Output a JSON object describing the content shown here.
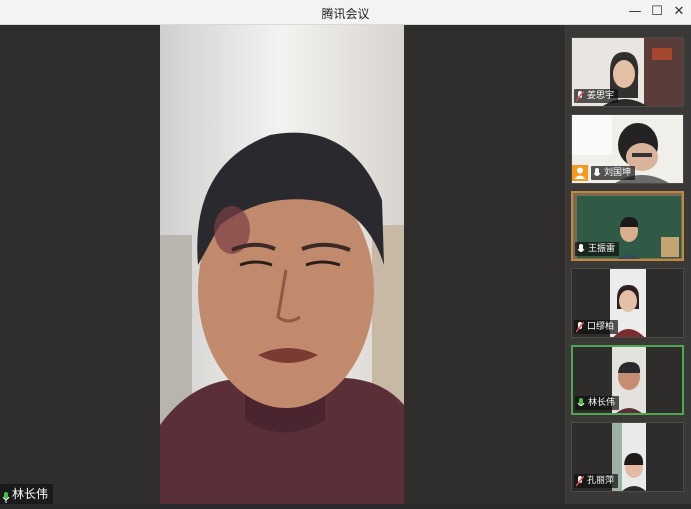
{
  "window": {
    "title": "腾讯会议",
    "minimize_glyph": "—",
    "maximize_glyph": "☐",
    "close_glyph": "✕"
  },
  "main_video": {
    "speaker_name": "林长伟",
    "mic_state": "speaking"
  },
  "participants": [
    {
      "name": "姜思宇",
      "mic": "muted",
      "state": "normal"
    },
    {
      "name": "刘国坤",
      "mic": "on",
      "state": "normal",
      "host": true
    },
    {
      "name": "王振雷",
      "mic": "on",
      "state": "speaking"
    },
    {
      "name": "口缪柏",
      "mic": "muted",
      "state": "normal"
    },
    {
      "name": "林长伟",
      "mic": "speaking",
      "state": "active"
    },
    {
      "name": "孔丽萍",
      "mic": "muted",
      "state": "normal"
    }
  ],
  "colors": {
    "mic_active": "#45c04a",
    "mic_muted": "#e04848",
    "active_border": "#4fa64f",
    "speaking_border": "#c08b3e",
    "host_badge": "#f39a1f"
  },
  "icons": {
    "mic_on": "microphone-icon",
    "mic_muted": "microphone-muted-icon",
    "host": "host-person-icon"
  }
}
